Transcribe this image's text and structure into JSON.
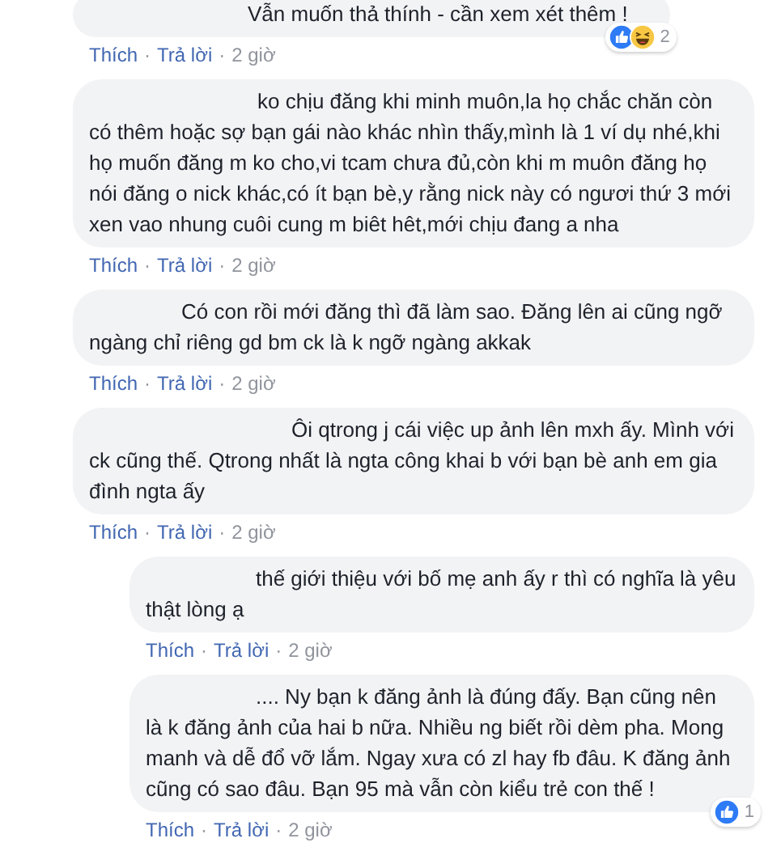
{
  "comments": [
    {
      "kind": "comment",
      "text": "Vẫn muốn thả thính - cần xem xét thêm !",
      "reactions": [
        {
          "kind": "like"
        },
        {
          "kind": "haha"
        }
      ],
      "reaction_count": "2",
      "actions": {
        "like": "Thích",
        "separator": "·",
        "reply": "Trả lời",
        "time": "2 giờ"
      }
    },
    {
      "kind": "comment",
      "text": "ko chịu đăng khi minh muôn,la họ chắc chăn còn có thêm hoặc sợ bạn gái nào khác nhìn thấy,mình là 1 ví dụ nhé,khi họ muốn đăng m ko cho,vi tcam chưa đủ,còn khi m muôn đăng họ nói đăng o nick khác,có ít bạn bè,y rằng nick này có ngươi thứ 3 mới xen vao nhung cuôi cung m biêt hêt,mới chịu đang a nha",
      "actions": {
        "like": "Thích",
        "separator": "·",
        "reply": "Trả lời",
        "time": "2 giờ"
      }
    },
    {
      "kind": "comment",
      "text": "Có con rồi mới đăng thì đã làm sao. Đăng lên ai cũng ngỡ ngàng chỉ riêng gd bm ck là k ngỡ ngàng akkak",
      "actions": {
        "like": "Thích",
        "separator": "·",
        "reply": "Trả lời",
        "time": "2 giờ"
      }
    },
    {
      "kind": "comment",
      "text": "Ôi qtrong j cái việc up ảnh lên mxh ấy. Mình với ck cũng thế. Qtrong nhất là ngta công khai b với bạn bè anh em gia đình ngta ấy",
      "actions": {
        "like": "Thích",
        "separator": "·",
        "reply": "Trả lời",
        "time": "2 giờ"
      }
    },
    {
      "kind": "reply",
      "text": "thế giới thiệu với bố mẹ anh ấy r thì có nghĩa là yêu thật lòng ạ",
      "actions": {
        "like": "Thích",
        "separator": "·",
        "reply": "Trả lời",
        "time": "2 giờ"
      }
    },
    {
      "kind": "reply",
      "text": ".... Ny bạn k đăng ảnh là đúng đấy. Bạn cũng nên là k đăng ảnh của hai b nữa. Nhiều ng biết rồi dèm pha. Mong manh và dễ đổ vỡ lắm. Ngay xưa có zl hay fb đâu. K đăng ảnh cũng có sao đâu. Bạn 95 mà vẫn còn kiểu trẻ con thế !",
      "reactions": [
        {
          "kind": "like"
        }
      ],
      "reaction_count": "1",
      "actions": {
        "like": "Thích",
        "separator": "·",
        "reply": "Trả lời",
        "time": "2 giờ"
      }
    }
  ]
}
